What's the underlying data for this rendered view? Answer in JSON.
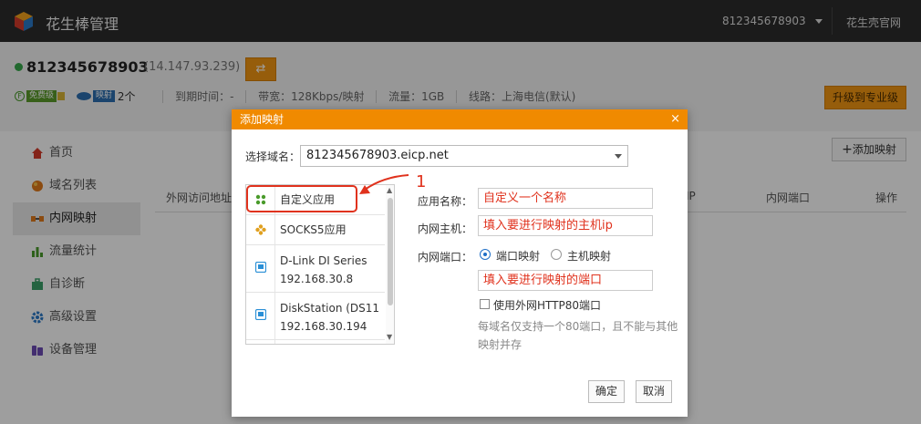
{
  "topbar": {
    "title": "花生棒管理",
    "user": "812345678903",
    "official_link": "花生壳官网"
  },
  "account": {
    "id": "812345678903",
    "ip": "(14.147.93.239)",
    "switch_icon": "⇄",
    "level_badge": "免费级",
    "map_badge": "映射",
    "map_count": "2个",
    "expire": "到期时间：-",
    "bandwidth": "带宽：128Kbps/映射",
    "traffic": "流量：1GB",
    "line": "线路：上海电信(默认)",
    "upgrade_label": "升级到专业级",
    "colors": {
      "online": "#36a84b",
      "accent": "#f39712"
    }
  },
  "sidebar": {
    "items": [
      {
        "label": "首页",
        "icon": "home-icon"
      },
      {
        "label": "域名列表",
        "icon": "globe-icon"
      },
      {
        "label": "内网映射",
        "icon": "mapping-icon"
      },
      {
        "label": "流量统计",
        "icon": "bar-chart-icon"
      },
      {
        "label": "自诊断",
        "icon": "toolbox-icon"
      },
      {
        "label": "高级设置",
        "icon": "gear-icon"
      },
      {
        "label": "设备管理",
        "icon": "device-icon"
      }
    ]
  },
  "content": {
    "add_button": "添加映射",
    "columns": {
      "external": "外网访问地址",
      "ip": "IP",
      "port": "内网端口",
      "action": "操作"
    }
  },
  "dialog": {
    "title": "添加映射",
    "close": "×",
    "domain_label": "选择域名：",
    "domain_value": "812345678903.eicp.net",
    "apps": [
      {
        "name": "自定义应用"
      },
      {
        "name": "SOCKS5应用"
      },
      {
        "name": "D-Link DI Series",
        "ip": "192.168.30.8"
      },
      {
        "name": "DiskStation (DS11",
        "ip": "192.168.30.194"
      }
    ],
    "annotation_number": "1",
    "app_name_label": "应用名称：",
    "app_name_value": "自定义一个名称",
    "host_label": "内网主机：",
    "host_value": "填入要进行映射的主机ip",
    "port_label": "内网端口：",
    "radio_port": "端口映射",
    "radio_host": "主机映射",
    "port_value": "填入要进行映射的端口",
    "checkbox_label": "使用外网HTTP80端口",
    "hint": "每域名仅支持一个80端口，且不能与其他映射并存",
    "ok": "确定",
    "cancel": "取消"
  }
}
